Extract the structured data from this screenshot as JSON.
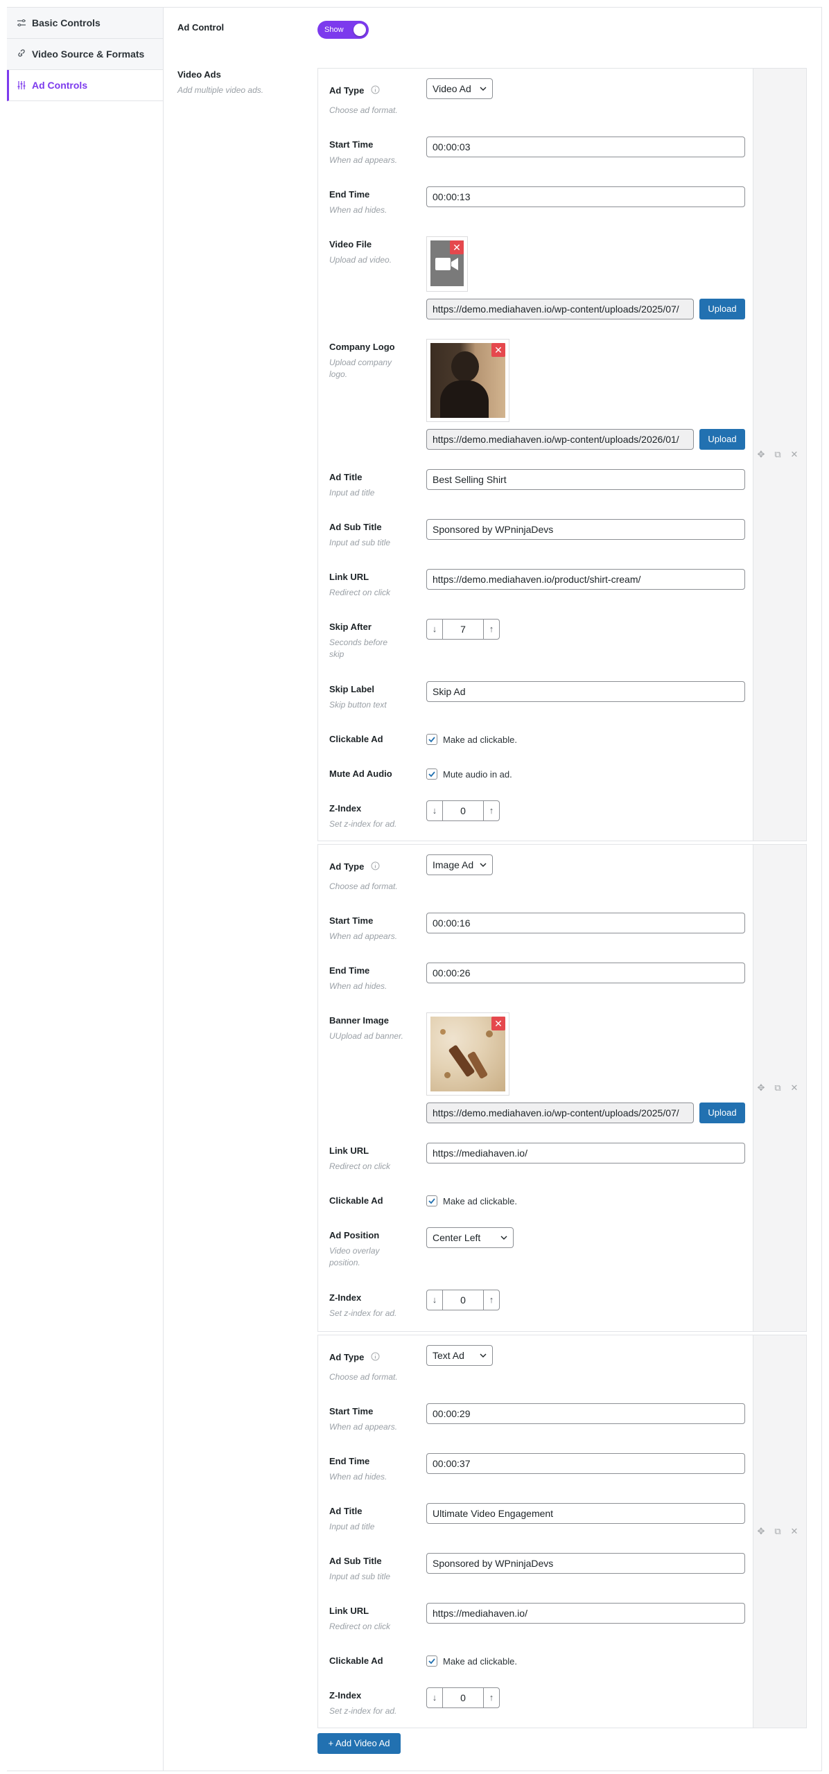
{
  "sidebar": {
    "items": [
      {
        "label": "Basic Controls",
        "icon": "sliders-icon"
      },
      {
        "label": "Video Source & Formats",
        "icon": "link-icon"
      },
      {
        "label": "Ad Controls",
        "icon": "vertical-sliders-icon",
        "active": true
      }
    ]
  },
  "ad_control": {
    "label": "Ad Control",
    "toggle_label": "Show",
    "enabled": true
  },
  "video_ads": {
    "label": "Video Ads",
    "description": "Add multiple video ads."
  },
  "ads": [
    {
      "ad_type": {
        "label": "Ad Type",
        "desc": "Choose ad format.",
        "value": "Video Ad"
      },
      "start_time": {
        "label": "Start Time",
        "desc": "When ad appears.",
        "value": "00:00:03"
      },
      "end_time": {
        "label": "End Time",
        "desc": "When ad hides.",
        "value": "00:00:13"
      },
      "video_file": {
        "label": "Video File",
        "desc": "Upload ad video.",
        "url": "https://demo.mediahaven.io/wp-content/uploads/2025/07/",
        "upload": "Upload"
      },
      "company_logo": {
        "label": "Company Logo",
        "desc": "Upload company logo.",
        "url": "https://demo.mediahaven.io/wp-content/uploads/2026/01/",
        "upload": "Upload"
      },
      "ad_title": {
        "label": "Ad Title",
        "desc": "Input ad title",
        "value": "Best Selling Shirt"
      },
      "ad_sub_title": {
        "label": "Ad Sub Title",
        "desc": "Input ad sub title",
        "value": "Sponsored by WPninjaDevs"
      },
      "link_url": {
        "label": "Link URL",
        "desc": "Redirect on click",
        "value": "https://demo.mediahaven.io/product/shirt-cream/"
      },
      "skip_after": {
        "label": "Skip After",
        "desc": "Seconds before skip",
        "value": "7"
      },
      "skip_label": {
        "label": "Skip Label",
        "desc": "Skip button text",
        "value": "Skip Ad"
      },
      "clickable": {
        "label": "Clickable Ad",
        "text": "Make ad clickable.",
        "checked": true
      },
      "mute": {
        "label": "Mute Ad Audio",
        "text": "Mute audio in ad.",
        "checked": true
      },
      "z_index": {
        "label": "Z-Index",
        "desc": "Set z-index for ad.",
        "value": "0"
      }
    },
    {
      "ad_type": {
        "label": "Ad Type",
        "desc": "Choose ad format.",
        "value": "Image Ad"
      },
      "start_time": {
        "label": "Start Time",
        "desc": "When ad appears.",
        "value": "00:00:16"
      },
      "end_time": {
        "label": "End Time",
        "desc": "When ad hides.",
        "value": "00:00:26"
      },
      "banner_image": {
        "label": "Banner Image",
        "desc": "UUpload ad banner.",
        "url": "https://demo.mediahaven.io/wp-content/uploads/2025/07/",
        "upload": "Upload"
      },
      "link_url": {
        "label": "Link URL",
        "desc": "Redirect on click",
        "value": "https://mediahaven.io/"
      },
      "clickable": {
        "label": "Clickable Ad",
        "text": "Make ad clickable.",
        "checked": true
      },
      "ad_position": {
        "label": "Ad Position",
        "desc": "Video overlay position.",
        "value": "Center Left"
      },
      "z_index": {
        "label": "Z-Index",
        "desc": "Set z-index for ad.",
        "value": "0"
      }
    },
    {
      "ad_type": {
        "label": "Ad Type",
        "desc": "Choose ad format.",
        "value": "Text Ad"
      },
      "start_time": {
        "label": "Start Time",
        "desc": "When ad appears.",
        "value": "00:00:29"
      },
      "end_time": {
        "label": "End Time",
        "desc": "When ad hides.",
        "value": "00:00:37"
      },
      "ad_title": {
        "label": "Ad Title",
        "desc": "Input ad title",
        "value": "Ultimate Video Engagement"
      },
      "ad_sub_title": {
        "label": "Ad Sub Title",
        "desc": "Input ad sub title",
        "value": "Sponsored by WPninjaDevs"
      },
      "link_url": {
        "label": "Link URL",
        "desc": "Redirect on click",
        "value": "https://mediahaven.io/"
      },
      "clickable": {
        "label": "Clickable Ad",
        "text": "Make ad clickable.",
        "checked": true
      },
      "z_index": {
        "label": "Z-Index",
        "desc": "Set z-index for ad.",
        "value": "0"
      }
    }
  ],
  "add_button": {
    "label": "+ Add Video Ad"
  },
  "colors": {
    "accent": "#7c3aed",
    "primary_button": "#2271b1",
    "remove": "#e5484d"
  }
}
